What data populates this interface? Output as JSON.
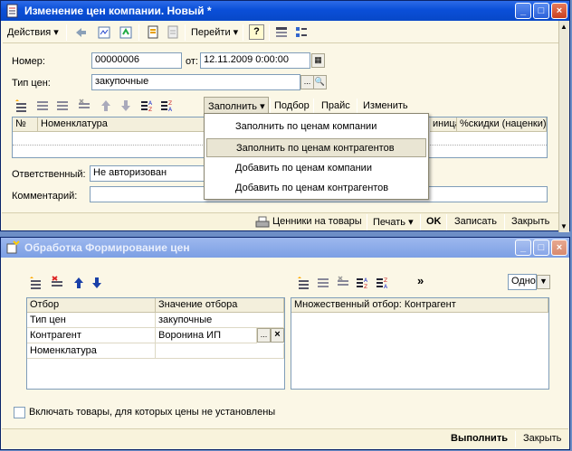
{
  "win1": {
    "title": "Изменение цен компании. Новый *",
    "toolbar": {
      "actions_label": "Действия",
      "goto_label": "Перейти",
      "help_label": "?"
    },
    "number_label": "Номер:",
    "number_value": "00000006",
    "from_label": "от:",
    "date_value": "12.11.2009  0:00:00",
    "price_type_label": "Тип цен:",
    "price_type_value": "закупочные",
    "tab_toolbar": {
      "fill_label": "Заполнить",
      "pick_label": "Подбор",
      "price_label": "Прайс",
      "change_label": "Изменить"
    },
    "table_headers": [
      "№",
      "Номенклатура",
      "иница",
      "%скидки (наценки)"
    ],
    "responsible_label": "Ответственный:",
    "responsible_value": "Не авторизован",
    "comment_label": "Комментарий:",
    "comment_value": "",
    "bottom": {
      "price_tags_label": "Ценники на товары",
      "print_label": "Печать",
      "ok_label": "OK",
      "record_label": "Записать",
      "close_label": "Закрыть"
    },
    "fill_menu": [
      "Заполнить по ценам компании",
      "Заполнить по ценам контрагентов",
      "Добавить по ценам компании",
      "Добавить по ценам контрагентов"
    ]
  },
  "win2": {
    "title": "Обработка  Формирование цен",
    "filter_table": {
      "headers": [
        "Отбор",
        "Значение отбора"
      ],
      "rows": [
        {
          "name": "Тип цен",
          "value": "закупочные"
        },
        {
          "name": "Контрагент",
          "value": "Воронина ИП"
        },
        {
          "name": "Номенклатура",
          "value": ""
        }
      ]
    },
    "more_label": "»",
    "mode_value": "Одно",
    "multi_filter_header": "Множественный отбор: Контрагент",
    "include_checkbox_label": "Включать товары, для которых цены не установлены",
    "bottom": {
      "execute_label": "Выполнить",
      "close_label": "Закрыть"
    }
  }
}
